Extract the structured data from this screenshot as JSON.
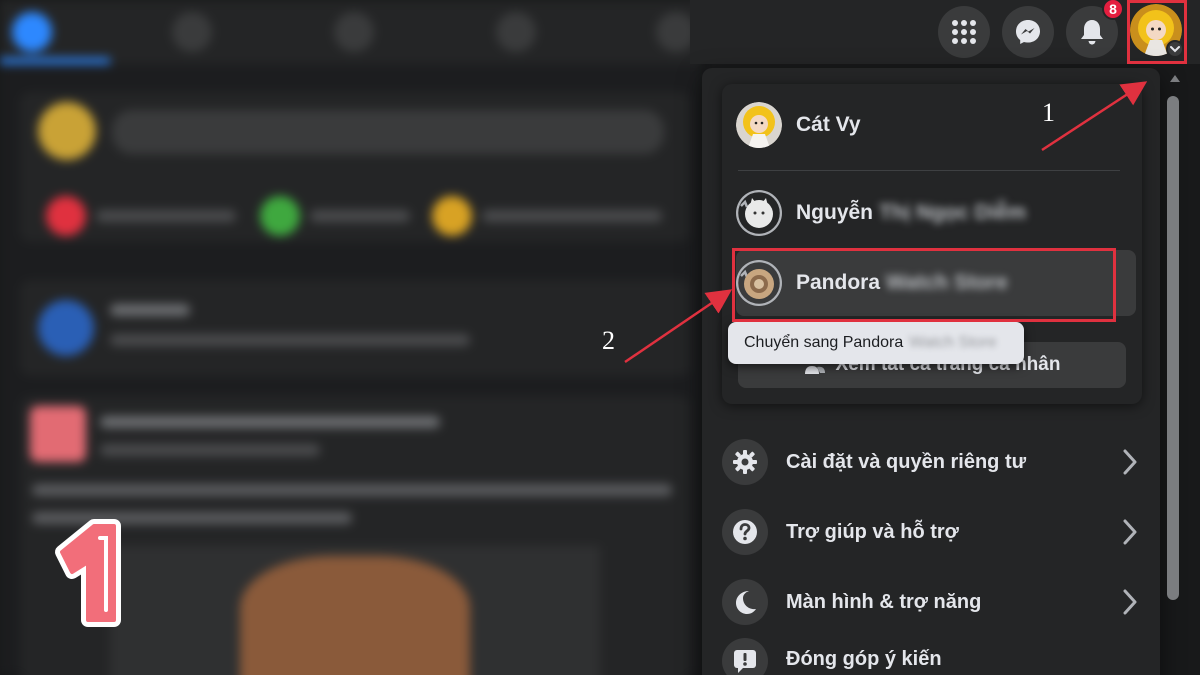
{
  "header": {
    "notification_count": "8"
  },
  "profiles": {
    "current": {
      "name": "Cát Vy"
    },
    "others": [
      {
        "name_visible": "Nguyễn",
        "name_blurred": "Thị Ngọc Diễm"
      },
      {
        "name_visible": "Pandora",
        "name_blurred": "Watch Store"
      }
    ],
    "tooltip": {
      "text": "Chuyển sang Pandora",
      "blurred": "Watch Store"
    },
    "see_all_label": "Xem tất cả trang cá nhân"
  },
  "menu": [
    {
      "label": "Cài đặt và quyền riêng tư",
      "icon": "gear-icon"
    },
    {
      "label": "Trợ giúp và hỗ trợ",
      "icon": "question-icon"
    },
    {
      "label": "Màn hình & trợ năng",
      "icon": "moon-icon"
    },
    {
      "label": "Đóng góp ý kiến",
      "icon": "feedback-icon"
    }
  ],
  "annotations": {
    "step1": "1",
    "step2": "2"
  },
  "colors": {
    "annotation_red": "#e0313f",
    "notification_red": "#e41e3f",
    "accent_blue": "#2d88ff",
    "panel_bg": "#242526"
  }
}
